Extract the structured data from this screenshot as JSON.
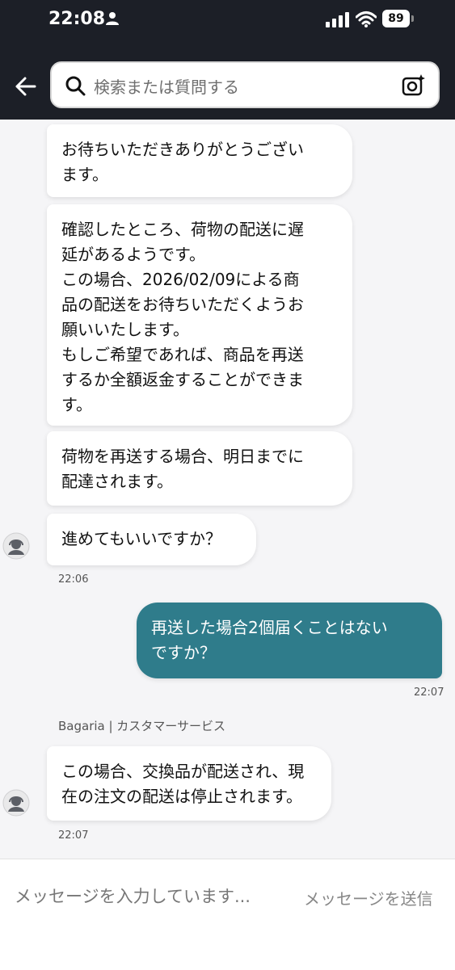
{
  "status_bar": {
    "time": "22:08",
    "battery": "89"
  },
  "search": {
    "placeholder": "検索または質問する"
  },
  "messages": [
    {
      "text": "お待ちいただきありがとうござい\nます。"
    },
    {
      "text": "確認したところ、荷物の配送に遅\n延があるようです。\nこの場合、2026/02/09による商\n品の配送をお待ちいただくようお\n願いいたします。\nもしご希望であれば、商品を再送\nするか全額返金することができま\nす。"
    },
    {
      "text": "荷物を再送する場合、明日までに\n配達されます。"
    },
    {
      "text": "進めてもいいですか？",
      "time": "22:06"
    },
    {
      "text": "再送した場合2個届くことはない\nですか？",
      "time": "22:07"
    },
    {
      "sender": "Bagaria | カスタマーサービス",
      "text": "この場合、交換品が配送され、現\n在の注文の配送は停止されます。",
      "time": "22:07"
    }
  ],
  "composer": {
    "placeholder": "メッセージを入力しています...",
    "send_label": "メッセージを送信"
  },
  "colors": {
    "header_bg": "#1c1f27",
    "user_bubble": "#2f7c8b",
    "agent_bubble": "#ffffff"
  }
}
